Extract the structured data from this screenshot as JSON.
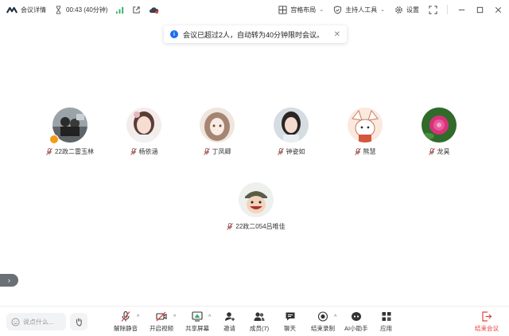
{
  "topbar": {
    "meeting_details": "会议详情",
    "timer": "00:43 (40分钟)",
    "layout": "宫格布局",
    "host_tools": "主持人工具",
    "settings": "设置"
  },
  "toast": {
    "message": "会议已超过2人，自动转为40分钟限时会议。",
    "close": "✕"
  },
  "participants": [
    {
      "name": "22政二雷玉林"
    },
    {
      "name": "杨依涵"
    },
    {
      "name": "丁凤卿"
    },
    {
      "name": "钟姿如"
    },
    {
      "name": "熊慧"
    },
    {
      "name": "龙昊"
    },
    {
      "name": "22政二054吕唯佳"
    }
  ],
  "bottombar": {
    "chat_placeholder": "说点什么...",
    "unmute": "解除静音",
    "start_video": "开启视频",
    "share_screen": "共享屏幕",
    "invite": "邀请",
    "members": "成员(7)",
    "chat": "聊天",
    "end_recording": "结束录制",
    "ai_assistant": "AI小助手",
    "apps": "应用",
    "end_meeting": "结束会议"
  },
  "colors": {
    "accent": "#1a6cf0",
    "danger": "#e8413d",
    "signal": "#27ae60"
  }
}
